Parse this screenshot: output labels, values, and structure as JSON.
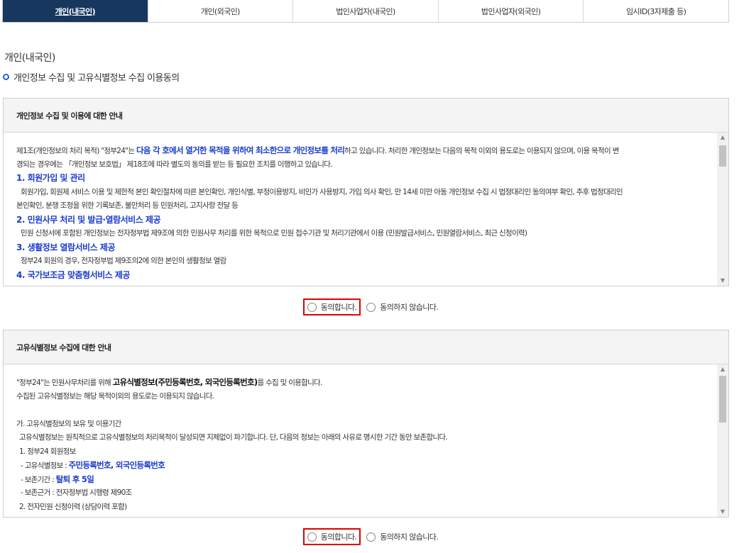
{
  "tabs": [
    "개인(내국인)",
    "개인(외국인)",
    "법인사업자(내국인)",
    "법인사업자(외국인)",
    "임시ID(3자제출 등)"
  ],
  "page_title": "개인(내국인)",
  "subtitle": "개인정보 수집 및 고유식별정보 수집 이용동의",
  "section1": {
    "title": "개인정보 수집 및 이용에 대한 안내",
    "intro_pre": "제1조(개인정보의 처리 목적) \"정부24\"는 ",
    "intro_bold": "다음 각 호에서 열거한 목적을 위하여 최소한으로 개인정보를 처리",
    "intro_post": "하고 있습니다. 처리한 개인정보는 다음의 목적 이외의 용도로는 이용되지 않으며, 이용 목적이 변",
    "intro_line2": "경되는 경우에는 「개인정보 보호법」 제18조에 따라 별도의 동의를 받는 등 필요한 조치를 이행하고 있습니다.",
    "item1_title": "1. 회원가입 및 관리",
    "item1_line1": "회원가입, 회원제 서비스 이용 및 제한적 본인 확인절차에 따른 본인확인, 개인식별, 부정이용방지, 비인가 사용방지, 가입 의사 확인, 만 14세 미만 아동 개인정보 수집 시 법정대리인 동의여부 확인, 추후 법정대리인",
    "item1_line2": "본인확인, 분쟁 조정을 위한 기록보존, 불만처리 등 민원처리, 고지사항 전달 등",
    "item2_title": "2. 민원사무 처리 및 발급·열람서비스 제공",
    "item2_line1": "민원 신청서에 포함된 개인정보는 전자정부법 제9조에 의한 민원사무 처리를 위한 목적으로 민원 접수기관 및 처리기관에서 이용 (민원발급서비스, 민원열람서비스, 최근 신청이력)",
    "item3_title": "3. 생활정보 열람서비스 제공",
    "item3_line1": "정부24 회원의 경우, 전자정부법 제9조의2에 의한 본인의 생활정보 열람",
    "item4_title": "4. 국가보조금 맞춤형서비스 제공"
  },
  "section2": {
    "title": "고유식별정보 수집에 대한 안내",
    "line1_pre": "\"정부24\"는 민원사무처리를 위해 ",
    "line1_bold": "고유식별정보(주민등록번호, 외국인등록번호)",
    "line1_post": "를 수집 및 이용합니다.",
    "line2": "수집된 고유식별정보는 해당 목적이외의 용도로는 이용되지 않습니다.",
    "line3": "가. 고유식별정보의 보유 및 이용기간",
    "line4": "고유식별정보는 원칙적으로 고유식별정보의 처리목적이 달성되면 지체없이 파기합니다. 단, 다음의 정보는 아래의 사유로 명시한 기간 동안 보존합니다.",
    "line5": "1. 정부24 회원정보",
    "line6_pre": "- 고유식별정보 : ",
    "line6_bold": "주민등록번호, 외국인등록번호",
    "line7_pre": "- 보존기간 : ",
    "line7_bold": "탈퇴 후 5일",
    "line8": "- 보존근거 : 전자정부법 시행령 제90조",
    "line9": "2. 전자민원 신청이력 (상담이력 포함)"
  },
  "agree": {
    "yes": "동의합니다.",
    "no": "동의하지 않습니다."
  },
  "colors": {
    "tab_active": "#17375e",
    "highlight": "#1a3ccc",
    "selection_box": "#e00000"
  }
}
